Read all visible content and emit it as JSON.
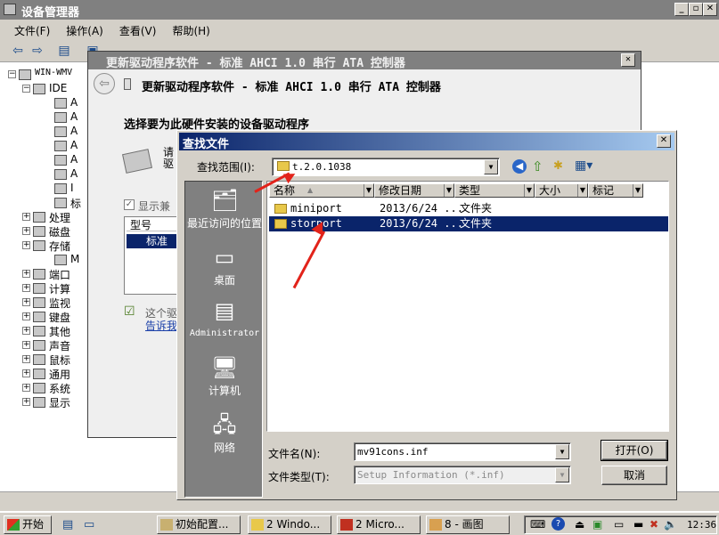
{
  "devmgr": {
    "title": "设备管理器",
    "menu": [
      "文件(F)",
      "操作(A)",
      "查看(V)",
      "帮助(H)"
    ],
    "tree": [
      {
        "label": "WIN-WMV",
        "kind": "root"
      },
      {
        "label": "IDE",
        "kind": "group"
      },
      {
        "label": "A",
        "kind": "child"
      },
      {
        "label": "A",
        "kind": "child"
      },
      {
        "label": "A",
        "kind": "child"
      },
      {
        "label": "A",
        "kind": "child"
      },
      {
        "label": "A",
        "kind": "child"
      },
      {
        "label": "A",
        "kind": "child"
      },
      {
        "label": "I",
        "kind": "child"
      },
      {
        "label": "标",
        "kind": "child"
      },
      {
        "label": "处理",
        "kind": "cat"
      },
      {
        "label": "磁盘",
        "kind": "cat"
      },
      {
        "label": "存储",
        "kind": "cat"
      },
      {
        "label": "M",
        "kind": "child2"
      },
      {
        "label": "端口",
        "kind": "cat"
      },
      {
        "label": "计算",
        "kind": "cat"
      },
      {
        "label": "监视",
        "kind": "cat"
      },
      {
        "label": "键盘",
        "kind": "cat"
      },
      {
        "label": "其他",
        "kind": "cat"
      },
      {
        "label": "声音",
        "kind": "cat"
      },
      {
        "label": "鼠标",
        "kind": "cat"
      },
      {
        "label": "通用",
        "kind": "cat"
      },
      {
        "label": "系统",
        "kind": "cat"
      },
      {
        "label": "显示",
        "kind": "cat"
      }
    ]
  },
  "update_dialog": {
    "title": "更新驱动程序软件 - 标准 AHCI 1.0 串行 ATA 控制器",
    "header": "更新驱动程序软件 - 标准 AHCI 1.0 串行 ATA 控制器",
    "heading": "选择要为此硬件安装的设备驱动程序",
    "please": "请",
    "drive": "驱",
    "show_compat": "显示兼",
    "model_header": "型号",
    "model_item": "标准",
    "note": "这个驱",
    "tell_link": "告诉我"
  },
  "find_dialog": {
    "title": "查找文件",
    "look_in_label": "查找范围(I):",
    "look_in_value": "t.2.0.1038",
    "places": [
      "最近访问的位置",
      "桌面",
      "Administrator",
      "计算机",
      "网络"
    ],
    "columns": [
      "名称",
      "修改日期",
      "类型",
      "大小",
      "标记"
    ],
    "files": [
      {
        "name": "miniport",
        "date": "2013/6/24 ...",
        "type": "文件夹",
        "selected": false
      },
      {
        "name": "storport",
        "date": "2013/6/24 ...",
        "type": "文件夹",
        "selected": true
      }
    ],
    "filename_label": "文件名(N):",
    "filename_value": "mv91cons.inf",
    "filetype_label": "文件类型(T):",
    "filetype_value": "Setup Information (*.inf)",
    "open_button": "打开(O)",
    "cancel_button": "取消"
  },
  "taskbar": {
    "start": "开始",
    "tasks": [
      "初始配置...",
      "2 Windo...",
      "2 Micro...",
      "8 - 画图"
    ],
    "clock": "12:36"
  },
  "colors": {
    "title_active": "#0a246a",
    "title_inactive": "#808080",
    "selection": "#0a246a",
    "annotation_arrow": "#e2231a"
  }
}
